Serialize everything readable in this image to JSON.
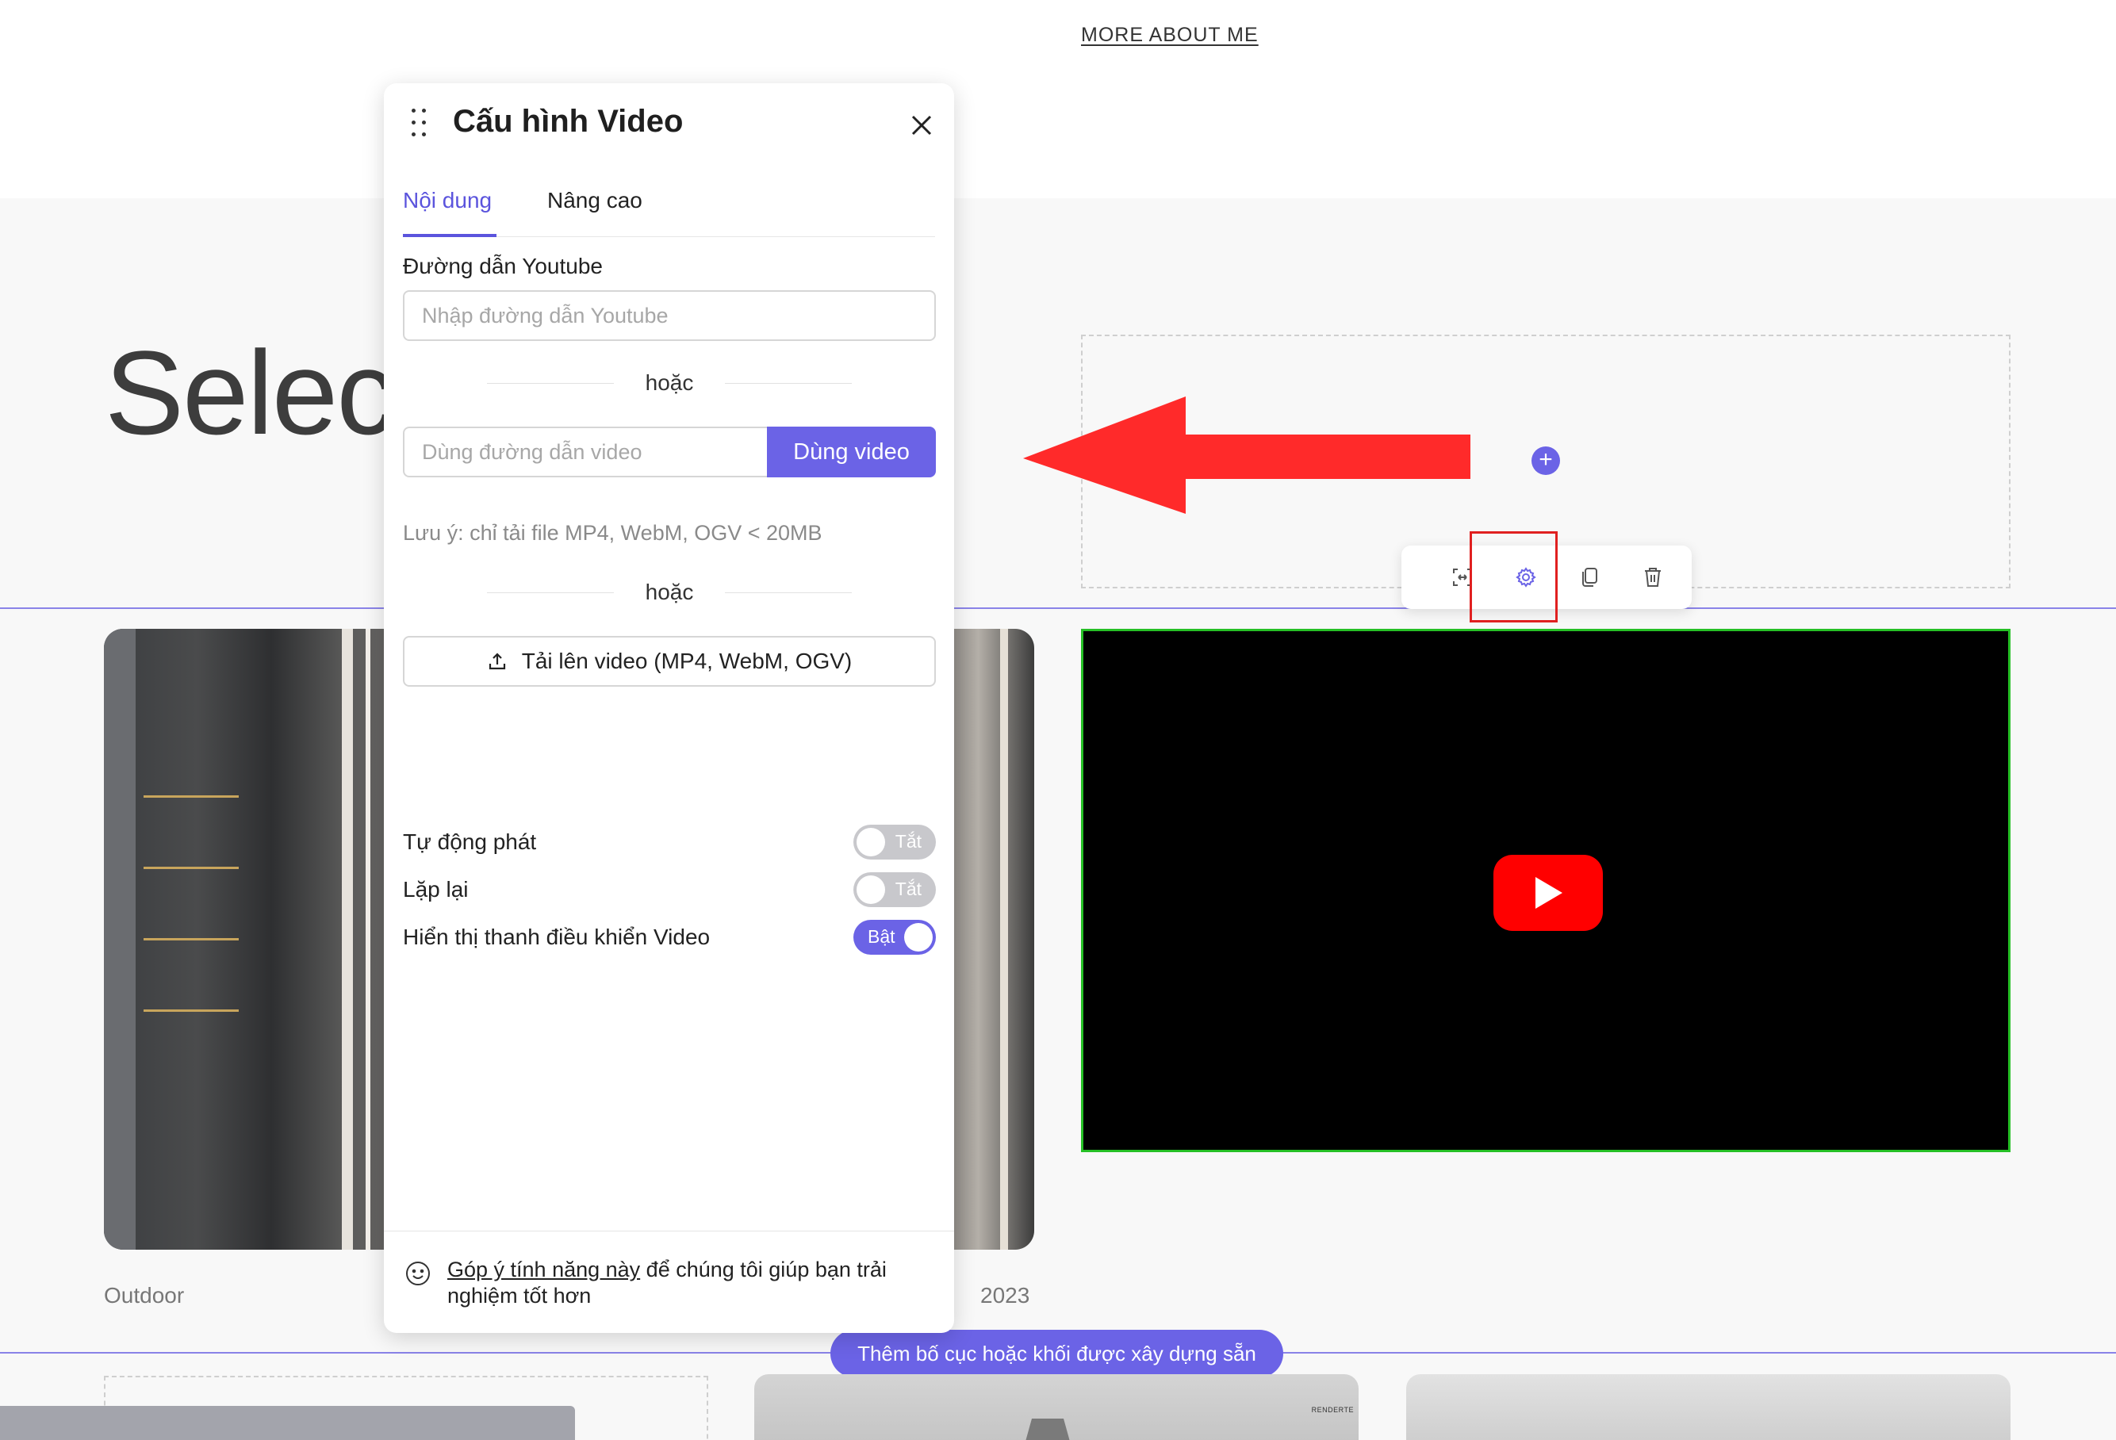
{
  "header": {
    "more_link": "MORE ABOUT ME"
  },
  "hero": {
    "title_fragment": "Selec"
  },
  "panel": {
    "title": "Cấu hình Video",
    "tabs": [
      {
        "label": "Nội dung",
        "active": true
      },
      {
        "label": "Nâng cao",
        "active": false
      }
    ],
    "youtube": {
      "label": "Đường dẫn Youtube",
      "placeholder": "Nhập đường dẫn Youtube",
      "value": ""
    },
    "or_text": "hoặc",
    "video_url": {
      "placeholder": "Dùng đường dẫn video",
      "value": "",
      "button": "Dùng video"
    },
    "note": "Lưu ý: chỉ tải file MP4, WebM, OGV < 20MB",
    "upload_button": "Tải lên video (MP4, WebM, OGV)",
    "toggles": [
      {
        "label": "Tự động phát",
        "state": "Tắt",
        "on": false
      },
      {
        "label": "Lặp lại",
        "state": "Tắt",
        "on": false
      },
      {
        "label": "Hiển thị thanh điều khiển Video",
        "state": "Bật",
        "on": true
      }
    ],
    "feedback": {
      "link": "Góp ý tính năng này",
      "text": " để chúng tôi giúp bạn trải nghiệm tốt hơn"
    }
  },
  "gallery": {
    "caption_left": "Outdoor",
    "caption_year": "2023",
    "add_prebuilt": "Thêm bố cục hoặc khối được xây dựng sẵn",
    "thumb_label": "RENDERTE"
  },
  "toolbar": {
    "icons": [
      "resize-icon",
      "gear-icon",
      "duplicate-icon",
      "trash-icon"
    ]
  },
  "colors": {
    "accent": "#6b63e6",
    "highlight_box": "#e02020",
    "arrow": "#ff2a2a",
    "video_border": "#26c026",
    "youtube_red": "#ff0000"
  }
}
